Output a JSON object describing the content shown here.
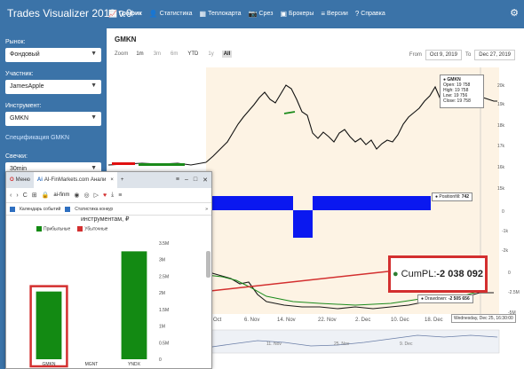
{
  "app": {
    "title": "Trades Visualizer 2019 v.0",
    "nav": [
      {
        "label": "График",
        "icon": "line-chart-icon",
        "glyph": "📈"
      },
      {
        "label": "Статистика",
        "icon": "user-icon",
        "glyph": "👤"
      },
      {
        "label": "Теплокарта",
        "icon": "table-icon",
        "glyph": "▦"
      },
      {
        "label": "Срез",
        "icon": "camera-icon",
        "glyph": "📷"
      },
      {
        "label": "Брокеры",
        "icon": "folder-icon",
        "glyph": "▣"
      },
      {
        "label": "Версии",
        "icon": "list-icon",
        "glyph": "≡"
      },
      {
        "label": "Справка",
        "icon": "question-icon",
        "glyph": "?"
      }
    ]
  },
  "sidebar": {
    "market_label": "Рынок:",
    "market_value": "Фондовый",
    "participant_label": "Участник:",
    "participant_value": "JamesApple",
    "instrument_label": "Инструмент:",
    "instrument_value": "GMKN",
    "spec_link": "Спецификация GMKN",
    "candles_label": "Свечки:",
    "candles_value": "30min"
  },
  "main": {
    "ticker": "GMKN",
    "zoom_label": "Zoom",
    "zoom_options": [
      "1m",
      "3m",
      "6m",
      "YTD",
      "1y",
      "All"
    ],
    "from_label": "From",
    "from_value": "Oct 9, 2019",
    "to_label": "To",
    "to_value": "Dec 27, 2019",
    "tooltip": {
      "title": "● GMKN",
      "open": "Open: 19 758",
      "high": "High: 19 758",
      "low": "Low: 19 756",
      "close": "Close: 19 758"
    },
    "position_label": "● Positionfill: ",
    "position_value": "742",
    "cumpl_label": "CumPL: ",
    "cumpl_value": "-2 038 092",
    "drawdown_label": "● Drawdown: ",
    "drawdown_value": "-2 505 656",
    "date_hint": "Wednesday, Dec 25, 16:30:00",
    "y_labels_price": [
      "20k",
      "19k",
      "18k",
      "17k",
      "16k",
      "15k"
    ],
    "y_labels_pos": [
      "0",
      "-1k",
      "-2k"
    ],
    "y_labels_pl": [
      "0",
      "-2.5M",
      "-5M"
    ],
    "x_labels": [
      "28. Oct",
      "6. Nov",
      "14. Nov",
      "22. Nov",
      "2. Dec",
      "10. Dec",
      "18. Dec"
    ],
    "nav_labels": [
      "11. Nov",
      "25. Nov",
      "9. Dec"
    ],
    "colors": {
      "position": "#0a18f0",
      "pl": "#1a1a1a",
      "highlight": "#d32f2f"
    }
  },
  "popup": {
    "tab1": "Меню",
    "tab2": "AI-FinMarkets.com Анали",
    "url": "ai-finm",
    "bookmark1": "Календарь событий",
    "bookmark2": "Статистика конкур",
    "chart_title": "инструментам, ₽",
    "legend_profit": "Прибыльные",
    "legend_loss": "Убыточные",
    "colors": {
      "profit": "#138a13",
      "loss": "#d32f2f"
    }
  },
  "chart_data": {
    "type": "bar",
    "categories": [
      "GMKN",
      "MGNT",
      "YNDX"
    ],
    "values": [
      2.04,
      0,
      3.25
    ],
    "ylabel": "",
    "ylim": [
      0,
      3.5
    ],
    "yticks": [
      "0",
      "0.5M",
      "1M",
      "1.5M",
      "2M",
      "2.5M",
      "3M",
      "3.5M"
    ]
  }
}
